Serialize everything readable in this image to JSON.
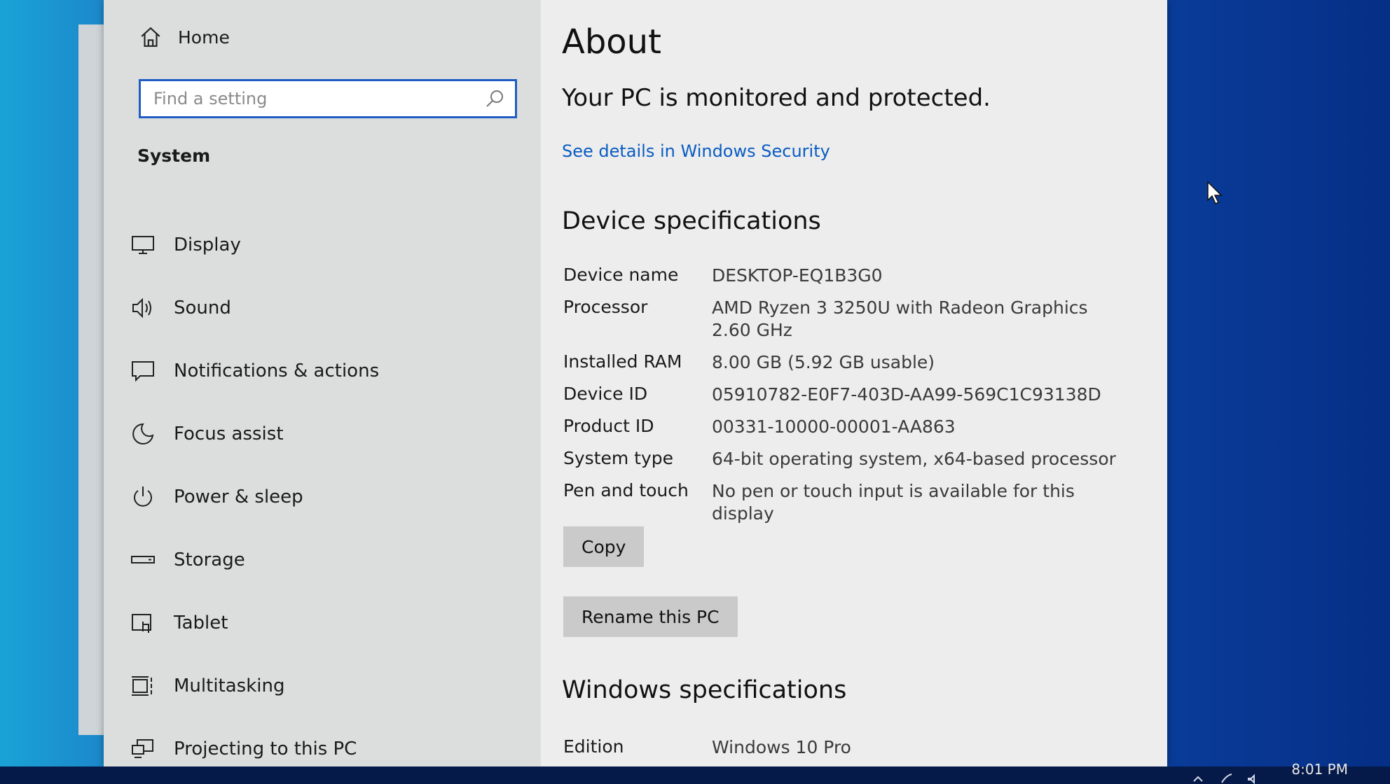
{
  "sidebar": {
    "home_label": "Home",
    "search_placeholder": "Find a setting",
    "section_label": "System",
    "items": [
      {
        "label": "Display",
        "icon": "display-icon"
      },
      {
        "label": "Sound",
        "icon": "sound-icon"
      },
      {
        "label": "Notifications & actions",
        "icon": "notifications-icon"
      },
      {
        "label": "Focus assist",
        "icon": "focus-assist-icon"
      },
      {
        "label": "Power & sleep",
        "icon": "power-icon"
      },
      {
        "label": "Storage",
        "icon": "storage-icon"
      },
      {
        "label": "Tablet",
        "icon": "tablet-icon"
      },
      {
        "label": "Multitasking",
        "icon": "multitasking-icon"
      },
      {
        "label": "Projecting to this PC",
        "icon": "projecting-icon"
      }
    ]
  },
  "content": {
    "title": "About",
    "protection_text": "Your PC is monitored and protected.",
    "security_link": "See details in Windows Security",
    "device_specs_heading": "Device specifications",
    "specs": [
      {
        "key": "Device name",
        "value": "DESKTOP-EQ1B3G0"
      },
      {
        "key": "Processor",
        "value": "AMD Ryzen 3 3250U with Radeon Graphics",
        "value2": "2.60 GHz"
      },
      {
        "key": "Installed RAM",
        "value": "8.00 GB (5.92 GB usable)"
      },
      {
        "key": "Device ID",
        "value": "05910782-E0F7-403D-AA99-569C1C93138D"
      },
      {
        "key": "Product ID",
        "value": "00331-10000-00001-AA863"
      },
      {
        "key": "System type",
        "value": "64-bit operating system, x64-based processor"
      },
      {
        "key": "Pen and touch",
        "value": "No pen or touch input is available for this display"
      }
    ],
    "copy_button": "Copy",
    "rename_button": "Rename this PC",
    "windows_specs_heading": "Windows specifications",
    "edition_key": "Edition",
    "edition_value": "Windows 10 Pro"
  },
  "taskbar": {
    "clock": "8:01 PM"
  },
  "colors": {
    "accent": "#1f5cc4",
    "link": "#0a5bc4",
    "desktop": "#1363b8"
  }
}
